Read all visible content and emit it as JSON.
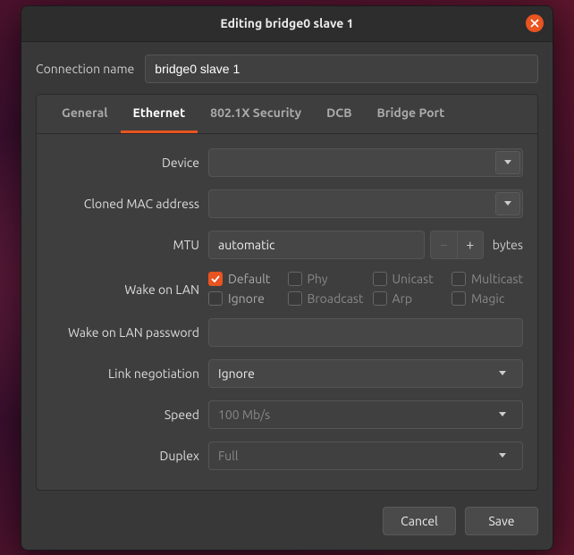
{
  "title": "Editing bridge0 slave 1",
  "connection": {
    "label": "Connection name",
    "value": "bridge0 slave 1"
  },
  "tabs": [
    {
      "label": "General"
    },
    {
      "label": "Ethernet"
    },
    {
      "label": "802.1X Security"
    },
    {
      "label": "DCB"
    },
    {
      "label": "Bridge Port"
    }
  ],
  "form": {
    "device": {
      "label": "Device",
      "value": ""
    },
    "cloned_mac": {
      "label": "Cloned MAC address",
      "value": ""
    },
    "mtu": {
      "label": "MTU",
      "value": "automatic",
      "unit": "bytes"
    },
    "wol": {
      "label": "Wake on LAN",
      "options": [
        {
          "label": "Default",
          "checked": true,
          "enabled": true
        },
        {
          "label": "Phy",
          "checked": false,
          "enabled": false
        },
        {
          "label": "Unicast",
          "checked": false,
          "enabled": false
        },
        {
          "label": "Multicast",
          "checked": false,
          "enabled": false
        },
        {
          "label": "Ignore",
          "checked": false,
          "enabled": true
        },
        {
          "label": "Broadcast",
          "checked": false,
          "enabled": false
        },
        {
          "label": "Arp",
          "checked": false,
          "enabled": false
        },
        {
          "label": "Magic",
          "checked": false,
          "enabled": false
        }
      ]
    },
    "wol_password": {
      "label": "Wake on LAN password",
      "value": ""
    },
    "link_negotiation": {
      "label": "Link negotiation",
      "value": "Ignore"
    },
    "speed": {
      "label": "Speed",
      "value": "100 Mb/s"
    },
    "duplex": {
      "label": "Duplex",
      "value": "Full"
    }
  },
  "buttons": {
    "cancel": "Cancel",
    "save": "Save"
  }
}
